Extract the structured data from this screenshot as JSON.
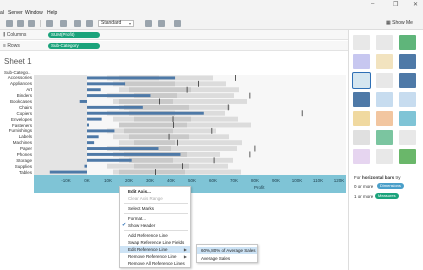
{
  "window": {
    "minimize": "–",
    "maximize": "❐",
    "close": "✕"
  },
  "menubar": {
    "items": [
      "al",
      "Server",
      "Window",
      "Help"
    ]
  },
  "toolbar": {
    "view_select": "Standard",
    "show_me_label": "Show Me",
    "icons": [
      "new-data-source-icon",
      "pause-icon",
      "swap-icon",
      "highlight-icon",
      "group-icon",
      "label-icon",
      "fit-icon",
      "presentation-icon",
      "share-icon"
    ]
  },
  "shelves": {
    "columns_label": "Columns",
    "columns_pill": "SUM(Profit)",
    "rows_label": "Rows",
    "rows_pill": "Sub-Category"
  },
  "sheet": {
    "title": "Sheet 1",
    "row_header": "Sub-Catego.."
  },
  "chart_data": {
    "type": "bar",
    "orientation": "horizontal",
    "categories": [
      "Accessories",
      "Appliances",
      "Art",
      "Binders",
      "Bookcases",
      "Chairs",
      "Copiers",
      "Envelopes",
      "Fasteners",
      "Furnishings",
      "Labels",
      "Machines",
      "Paper",
      "Phones",
      "Storage",
      "Supplies",
      "Tables"
    ],
    "values": [
      41936,
      18138,
      6528,
      30222,
      -3473,
      26590,
      55618,
      6964,
      950,
      13059,
      5546,
      3385,
      34053,
      44516,
      21279,
      -1189,
      -17725
    ],
    "xlabel": "Profit",
    "xlim": [
      -20000,
      120000
    ],
    "x_ticks": [
      "-10K",
      "0K",
      "10K",
      "20K",
      "30K",
      "40K",
      "50K",
      "60K",
      "70K",
      "80K",
      "90K",
      "100K",
      "110K",
      "120K"
    ],
    "reference_band": "60%,80% of Average Sales",
    "bar_color": "#4e79a7"
  },
  "context_menu": {
    "items": [
      {
        "label": "Edit Axis...",
        "enabled": true,
        "bold": true
      },
      {
        "label": "Clear Axis Range",
        "enabled": false
      },
      {
        "label": "Select Marks",
        "enabled": true
      },
      {
        "label": "Format...",
        "enabled": true
      },
      {
        "label": "Show Header",
        "enabled": true,
        "checked": true
      },
      {
        "label": "Add Reference Line",
        "enabled": true
      },
      {
        "label": "Swap Reference Line Fields",
        "enabled": true
      },
      {
        "label": "Edit Reference Line",
        "enabled": true,
        "submenu": true,
        "highlighted": true
      },
      {
        "label": "Remove Reference Line",
        "enabled": true,
        "submenu": true
      },
      {
        "label": "Remove All Reference Lines",
        "enabled": true
      }
    ],
    "submenu": [
      "60%,80% of Average Sales",
      "Average Sales"
    ]
  },
  "show_me": {
    "for_label": "For",
    "chart_name": "horizontal bars",
    "try_label": "try",
    "dimensions_prefix": "0 or more",
    "dimensions_pill": "Dimensions",
    "measures_prefix": "1 or more",
    "measures_pill": "Measures"
  },
  "colors": {
    "accent_green": "#1ba37b",
    "axis_blue": "#7fc4d6",
    "bar_blue": "#4e79a7",
    "highlight": "#cde3f5",
    "dimension_pill": "#4a9fc9",
    "measure_pill": "#1ba37b"
  }
}
